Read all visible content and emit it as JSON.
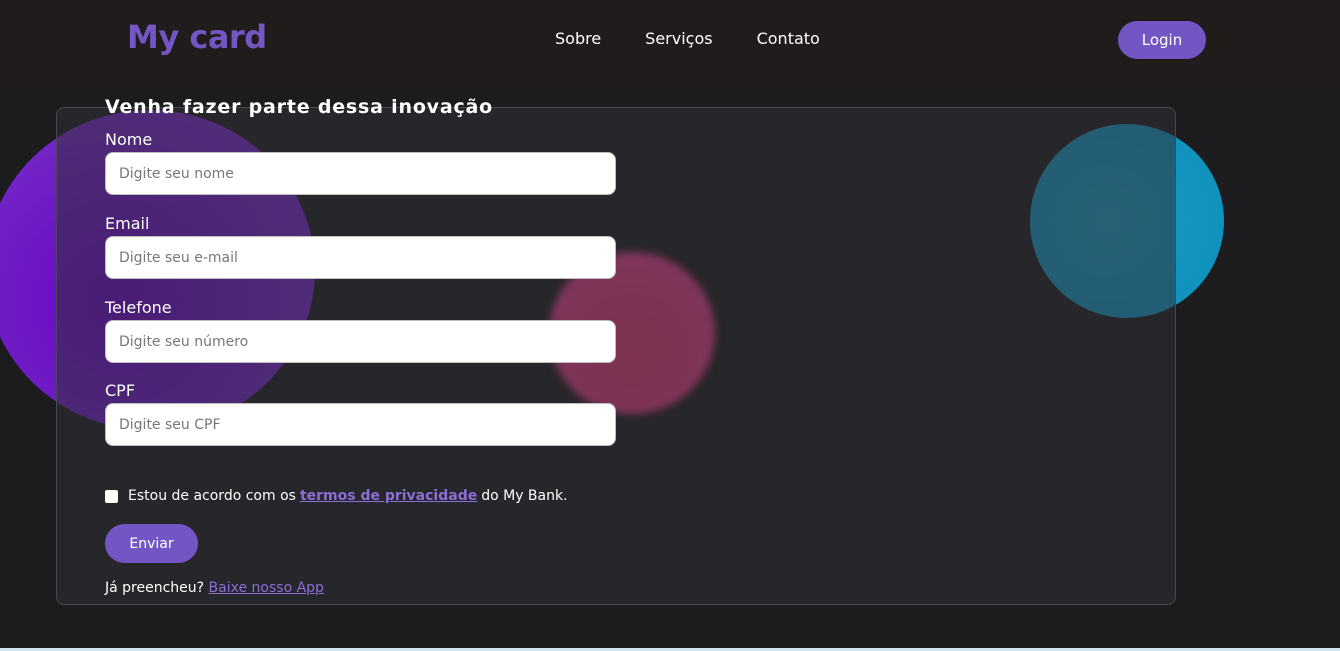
{
  "header": {
    "logo": "My card",
    "nav": [
      "Sobre",
      "Serviços",
      "Contato"
    ],
    "login_label": "Login"
  },
  "form": {
    "title": "Venha fazer parte dessa inovação",
    "fields": [
      {
        "label": "Nome",
        "placeholder": "Digite seu nome",
        "value": ""
      },
      {
        "label": "Email",
        "placeholder": "Digite seu e-mail",
        "value": ""
      },
      {
        "label": "Telefone",
        "placeholder": "Digite seu número",
        "value": ""
      },
      {
        "label": "CPF",
        "placeholder": "Digite seu CPF",
        "value": ""
      }
    ],
    "terms": {
      "prefix": "Estou de acordo com os",
      "link": "termos de privacidade",
      "suffix": "do My Bank.",
      "checked": false
    },
    "submit_label": "Enviar",
    "app_prompt": "Já preencheu?",
    "app_link": "Baixe nosso App"
  },
  "colors": {
    "accent": "#7356c4",
    "link": "#8a6fd6",
    "header_bg": "#211c1b",
    "page_bg": "#1c1b1d"
  }
}
